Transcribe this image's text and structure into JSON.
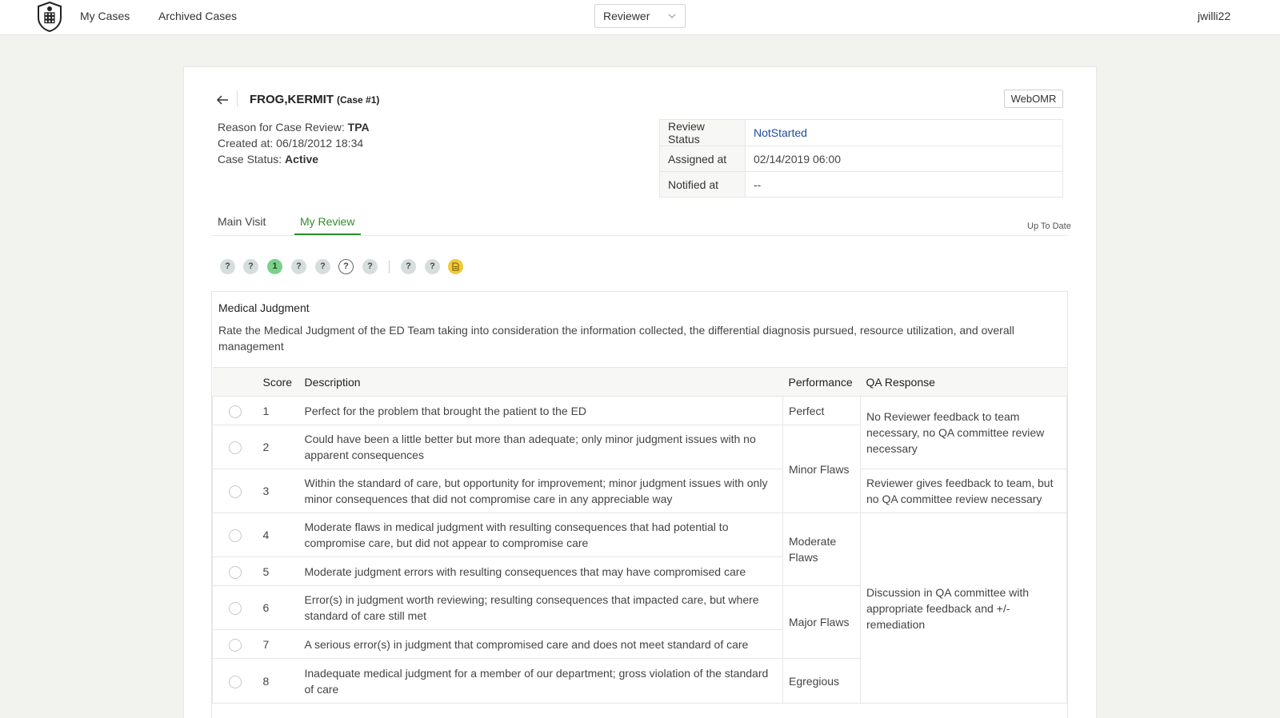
{
  "nav": {
    "my_cases": "My Cases",
    "archived_cases": "Archived Cases",
    "role_value": "Reviewer",
    "username": "jwilli22"
  },
  "case": {
    "patient_name": "FROG,KERMIT",
    "case_number": "(Case #1)",
    "webomr_label": "WebOMR",
    "reason_label": "Reason for Case Review: ",
    "reason_value": "TPA",
    "created_label": "Created at: 06/18/2012 18:34",
    "status_label": "Case Status: ",
    "status_value": "Active"
  },
  "status_table": {
    "review_status_label": "Review Status",
    "review_status_value": "NotStarted",
    "assigned_label": "Assigned at",
    "assigned_value": "02/14/2019 06:00",
    "notified_label": "Notified at",
    "notified_value": "--"
  },
  "tabs": {
    "main_visit": "Main Visit",
    "my_review": "My Review",
    "sync_status": "Up To Date"
  },
  "question_nav": [
    {
      "label": "?",
      "state": "unanswered"
    },
    {
      "label": "?",
      "state": "unanswered"
    },
    {
      "label": "1",
      "state": "answered"
    },
    {
      "label": "?",
      "state": "unanswered"
    },
    {
      "label": "?",
      "state": "unanswered"
    },
    {
      "label": "?",
      "state": "current"
    },
    {
      "label": "?",
      "state": "unanswered"
    },
    {
      "label": "?",
      "state": "unanswered"
    },
    {
      "label": "?",
      "state": "unanswered"
    },
    {
      "label": "",
      "state": "note",
      "icon": "note-icon"
    }
  ],
  "question": {
    "title": "Medical Judgment",
    "description": "Rate the Medical Judgment of the ED Team taking into consideration the information collected, the differential diagnosis pursued, resource utilization, and overall management",
    "headers": {
      "score": "Score",
      "description": "Description",
      "performance": "Performance",
      "qa_response": "QA Response"
    },
    "rows": [
      {
        "score": "1",
        "description": "Perfect for the problem that brought the patient to the ED"
      },
      {
        "score": "2",
        "description": "Could have been a little better but more than adequate; only minor judgment issues with no apparent consequences"
      },
      {
        "score": "3",
        "description": "Within the standard of care, but opportunity for improvement; minor judgment issues with only minor consequences that did not compromise care in any appreciable way"
      },
      {
        "score": "4",
        "description": "Moderate flaws in medical judgment with resulting consequences that had potential to compromise care, but did not appear to compromise care"
      },
      {
        "score": "5",
        "description": "Moderate judgment errors with resulting consequences that may have compromised care"
      },
      {
        "score": "6",
        "description": "Error(s) in judgment worth reviewing; resulting consequences that impacted care, but where standard of care still met"
      },
      {
        "score": "7",
        "description": "A serious error(s) in judgment that compromised care and does not meet standard of care"
      },
      {
        "score": "8",
        "description": "Inadequate medical judgment for a member of our department; gross violation of the standard of care"
      }
    ],
    "performance": {
      "perfect": "Perfect",
      "minor": "Minor Flaws",
      "moderate": "Moderate Flaws",
      "major": "Major Flaws",
      "egregious": "Egregious"
    },
    "qa_responses": {
      "r1": "No Reviewer feedback to team necessary, no QA committee review necessary",
      "r2": "Reviewer gives feedback to team, but no QA committee review necessary",
      "r3": "Discussion in QA committee with appropriate feedback and +/- remediation"
    }
  },
  "colors": {
    "accent_green": "#2f8f2f",
    "link_blue": "#1f4ba0",
    "answered_dot": "#7bd18a",
    "note_dot": "#f0c93e"
  }
}
